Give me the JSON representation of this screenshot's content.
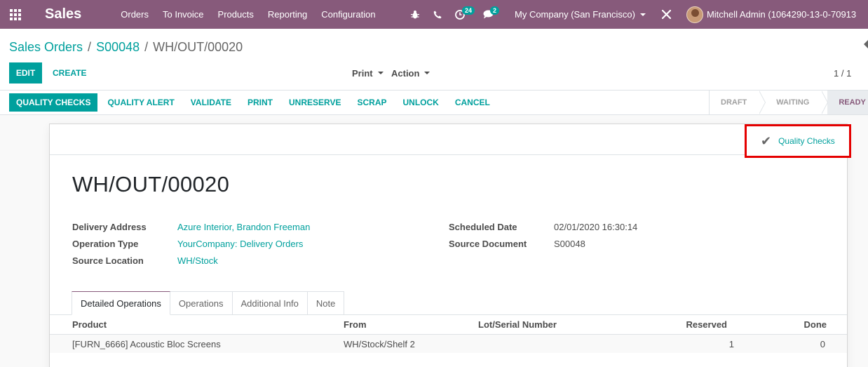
{
  "navbar": {
    "app_name": "Sales",
    "menu": [
      "Orders",
      "To Invoice",
      "Products",
      "Reporting",
      "Configuration"
    ],
    "activity_count": "24",
    "messages_count": "2",
    "company": "My Company (San Francisco)",
    "user": "Mitchell Admin (1064290-13-0-70913"
  },
  "breadcrumb": {
    "root": "Sales Orders",
    "order": "S00048",
    "current": "WH/OUT/00020"
  },
  "control": {
    "edit_label": "EDIT",
    "create_label": "CREATE",
    "print_label": "Print",
    "action_label": "Action",
    "pager": "1 / 1"
  },
  "statusbar": {
    "buttons": [
      "QUALITY CHECKS",
      "QUALITY ALERT",
      "VALIDATE",
      "PRINT",
      "UNRESERVE",
      "SCRAP",
      "UNLOCK",
      "CANCEL"
    ],
    "stages": [
      "DRAFT",
      "WAITING",
      "READY"
    ],
    "active_stage": "READY"
  },
  "form": {
    "smart_button_label": "Quality Checks",
    "title": "WH/OUT/00020",
    "left_fields": [
      {
        "label": "Delivery Address",
        "value": "Azure Interior, Brandon Freeman"
      },
      {
        "label": "Operation Type",
        "value": "YourCompany: Delivery Orders"
      },
      {
        "label": "Source Location",
        "value": "WH/Stock"
      }
    ],
    "right_fields": [
      {
        "label": "Scheduled Date",
        "value": "02/01/2020 16:30:14"
      },
      {
        "label": "Source Document",
        "value": "S00048"
      }
    ],
    "tabs": [
      "Detailed Operations",
      "Operations",
      "Additional Info",
      "Note"
    ],
    "table": {
      "headers": [
        "Product",
        "From",
        "Lot/Serial Number",
        "Reserved",
        "Done"
      ],
      "rows": [
        {
          "product": "[FURN_6666] Acoustic Bloc Screens",
          "from": "WH/Stock/Shelf 2",
          "lot": "",
          "reserved": "1",
          "done": "0"
        }
      ]
    }
  },
  "colors": {
    "navbar": "#875a7b",
    "accent": "#00a09d",
    "highlight_border": "#e50000"
  }
}
